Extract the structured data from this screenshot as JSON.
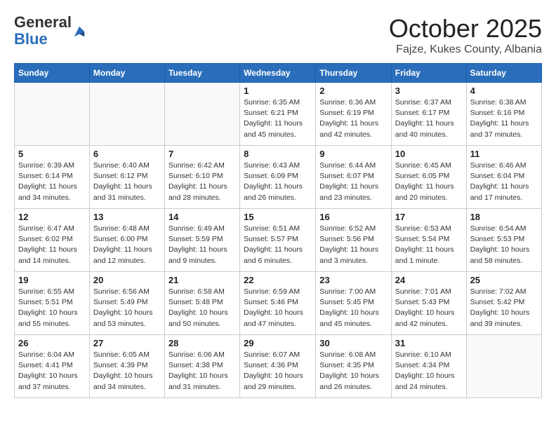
{
  "header": {
    "logo_general": "General",
    "logo_blue": "Blue",
    "month": "October 2025",
    "location": "Fajze, Kukes County, Albania"
  },
  "weekdays": [
    "Sunday",
    "Monday",
    "Tuesday",
    "Wednesday",
    "Thursday",
    "Friday",
    "Saturday"
  ],
  "weeks": [
    [
      {
        "day": "",
        "info": ""
      },
      {
        "day": "",
        "info": ""
      },
      {
        "day": "",
        "info": ""
      },
      {
        "day": "1",
        "info": "Sunrise: 6:35 AM\nSunset: 6:21 PM\nDaylight: 11 hours\nand 45 minutes."
      },
      {
        "day": "2",
        "info": "Sunrise: 6:36 AM\nSunset: 6:19 PM\nDaylight: 11 hours\nand 42 minutes."
      },
      {
        "day": "3",
        "info": "Sunrise: 6:37 AM\nSunset: 6:17 PM\nDaylight: 11 hours\nand 40 minutes."
      },
      {
        "day": "4",
        "info": "Sunrise: 6:38 AM\nSunset: 6:16 PM\nDaylight: 11 hours\nand 37 minutes."
      }
    ],
    [
      {
        "day": "5",
        "info": "Sunrise: 6:39 AM\nSunset: 6:14 PM\nDaylight: 11 hours\nand 34 minutes."
      },
      {
        "day": "6",
        "info": "Sunrise: 6:40 AM\nSunset: 6:12 PM\nDaylight: 11 hours\nand 31 minutes."
      },
      {
        "day": "7",
        "info": "Sunrise: 6:42 AM\nSunset: 6:10 PM\nDaylight: 11 hours\nand 28 minutes."
      },
      {
        "day": "8",
        "info": "Sunrise: 6:43 AM\nSunset: 6:09 PM\nDaylight: 11 hours\nand 26 minutes."
      },
      {
        "day": "9",
        "info": "Sunrise: 6:44 AM\nSunset: 6:07 PM\nDaylight: 11 hours\nand 23 minutes."
      },
      {
        "day": "10",
        "info": "Sunrise: 6:45 AM\nSunset: 6:05 PM\nDaylight: 11 hours\nand 20 minutes."
      },
      {
        "day": "11",
        "info": "Sunrise: 6:46 AM\nSunset: 6:04 PM\nDaylight: 11 hours\nand 17 minutes."
      }
    ],
    [
      {
        "day": "12",
        "info": "Sunrise: 6:47 AM\nSunset: 6:02 PM\nDaylight: 11 hours\nand 14 minutes."
      },
      {
        "day": "13",
        "info": "Sunrise: 6:48 AM\nSunset: 6:00 PM\nDaylight: 11 hours\nand 12 minutes."
      },
      {
        "day": "14",
        "info": "Sunrise: 6:49 AM\nSunset: 5:59 PM\nDaylight: 11 hours\nand 9 minutes."
      },
      {
        "day": "15",
        "info": "Sunrise: 6:51 AM\nSunset: 5:57 PM\nDaylight: 11 hours\nand 6 minutes."
      },
      {
        "day": "16",
        "info": "Sunrise: 6:52 AM\nSunset: 5:56 PM\nDaylight: 11 hours\nand 3 minutes."
      },
      {
        "day": "17",
        "info": "Sunrise: 6:53 AM\nSunset: 5:54 PM\nDaylight: 11 hours\nand 1 minute."
      },
      {
        "day": "18",
        "info": "Sunrise: 6:54 AM\nSunset: 5:53 PM\nDaylight: 10 hours\nand 58 minutes."
      }
    ],
    [
      {
        "day": "19",
        "info": "Sunrise: 6:55 AM\nSunset: 5:51 PM\nDaylight: 10 hours\nand 55 minutes."
      },
      {
        "day": "20",
        "info": "Sunrise: 6:56 AM\nSunset: 5:49 PM\nDaylight: 10 hours\nand 53 minutes."
      },
      {
        "day": "21",
        "info": "Sunrise: 6:58 AM\nSunset: 5:48 PM\nDaylight: 10 hours\nand 50 minutes."
      },
      {
        "day": "22",
        "info": "Sunrise: 6:59 AM\nSunset: 5:46 PM\nDaylight: 10 hours\nand 47 minutes."
      },
      {
        "day": "23",
        "info": "Sunrise: 7:00 AM\nSunset: 5:45 PM\nDaylight: 10 hours\nand 45 minutes."
      },
      {
        "day": "24",
        "info": "Sunrise: 7:01 AM\nSunset: 5:43 PM\nDaylight: 10 hours\nand 42 minutes."
      },
      {
        "day": "25",
        "info": "Sunrise: 7:02 AM\nSunset: 5:42 PM\nDaylight: 10 hours\nand 39 minutes."
      }
    ],
    [
      {
        "day": "26",
        "info": "Sunrise: 6:04 AM\nSunset: 4:41 PM\nDaylight: 10 hours\nand 37 minutes."
      },
      {
        "day": "27",
        "info": "Sunrise: 6:05 AM\nSunset: 4:39 PM\nDaylight: 10 hours\nand 34 minutes."
      },
      {
        "day": "28",
        "info": "Sunrise: 6:06 AM\nSunset: 4:38 PM\nDaylight: 10 hours\nand 31 minutes."
      },
      {
        "day": "29",
        "info": "Sunrise: 6:07 AM\nSunset: 4:36 PM\nDaylight: 10 hours\nand 29 minutes."
      },
      {
        "day": "30",
        "info": "Sunrise: 6:08 AM\nSunset: 4:35 PM\nDaylight: 10 hours\nand 26 minutes."
      },
      {
        "day": "31",
        "info": "Sunrise: 6:10 AM\nSunset: 4:34 PM\nDaylight: 10 hours\nand 24 minutes."
      },
      {
        "day": "",
        "info": ""
      }
    ]
  ]
}
